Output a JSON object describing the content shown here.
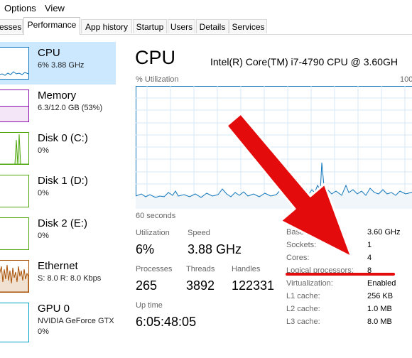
{
  "menu": {
    "options": "Options",
    "view": "View"
  },
  "tabs": [
    "esses",
    "Performance",
    "App history",
    "Startup",
    "Users",
    "Details",
    "Services"
  ],
  "sidebar": {
    "items": [
      {
        "title": "CPU",
        "sub": "6%  3.88 GHz"
      },
      {
        "title": "Memory",
        "sub": "6.3/12.0 GB (53%)"
      },
      {
        "title": "Disk 0 (C:)",
        "sub": "0%"
      },
      {
        "title": "Disk 1 (D:)",
        "sub": "0%"
      },
      {
        "title": "Disk 2 (E:)",
        "sub": "0%"
      },
      {
        "title": "Ethernet",
        "sub": "S: 8.0  R: 8.0 Kbps"
      },
      {
        "title": "GPU 0",
        "sub": "NVIDIA GeForce GTX",
        "sub2": "0%"
      }
    ]
  },
  "main": {
    "title": "CPU",
    "model": "Intel(R) Core(TM) i7-4790 CPU @ 3.60GH",
    "util_label": "% Utilization",
    "util_max": "100",
    "time_label": "60 seconds",
    "stats": {
      "utilization_label": "Utilization",
      "utilization": "6%",
      "speed_label": "Speed",
      "speed": "3.88 GHz",
      "processes_label": "Processes",
      "processes": "265",
      "threads_label": "Threads",
      "threads": "3892",
      "handles_label": "Handles",
      "handles": "122331",
      "uptime_label": "Up time",
      "uptime": "6:05:48:05"
    },
    "info": [
      {
        "label": "Base",
        "value": "3.60 GHz"
      },
      {
        "label": "Sockets:",
        "value": "1"
      },
      {
        "label": "Cores:",
        "value": "4"
      },
      {
        "label": "Logical processors:",
        "value": "8"
      },
      {
        "label": "Virtualization:",
        "value": "Enabled"
      },
      {
        "label": "L1 cache:",
        "value": "256 KB"
      },
      {
        "label": "L2 cache:",
        "value": "1.0 MB"
      },
      {
        "label": "L3 cache:",
        "value": "8.0 MB"
      }
    ]
  },
  "colors": {
    "cpu": "#1177bb",
    "memory": "#8b12ae",
    "disk": "#4da60c",
    "ethernet": "#a74f01",
    "gpu": "#00a0c8",
    "annotation": "#e30b0b",
    "selected": "#cce8ff"
  }
}
